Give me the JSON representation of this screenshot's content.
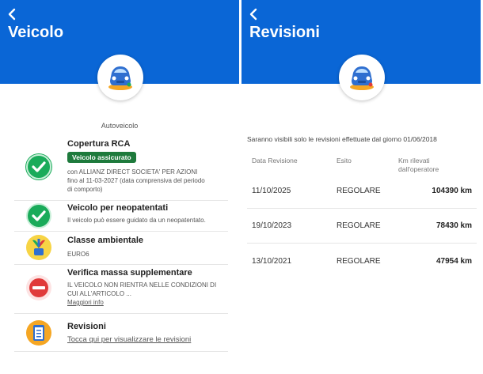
{
  "left": {
    "title": "Veicolo",
    "section_label": "Autoveicolo",
    "rca": {
      "title": "Copertura RCA",
      "badge": "Veicolo assicurato",
      "detail1": "con ALLIANZ DIRECT SOCIETA' PER AZIONI",
      "detail2": "fino al 11-03-2027 (data comprensiva del periodo",
      "detail3": "di comporto)"
    },
    "neopatentati": {
      "title": "Veicolo per neopatentati",
      "detail": "Il veicolo può essere guidato da un neopatentato."
    },
    "classe": {
      "title": "Classe ambientale",
      "detail": "EURO6"
    },
    "massa": {
      "title": "Verifica massa supplementare",
      "detail1": "IL VEICOLO NON RIENTRA NELLE CONDIZIONI DI",
      "detail2": "CUI ALL'ARTICOLO ...",
      "link": "Maggiori info"
    },
    "revisioni": {
      "title": "Revisioni",
      "link": "Tocca qui per visualizzare le revisioni"
    }
  },
  "right": {
    "title": "Revisioni",
    "note": "Saranno visibili solo le revisioni effettuate dal giorno 01/06/2018",
    "columns": {
      "date": "Data Revisione",
      "esito": "Esito",
      "km1": "Km rilevati",
      "km2": "dall'operatore"
    },
    "rows": [
      {
        "date": "11/10/2025",
        "esito": "REGOLARE",
        "km": "104390 km"
      },
      {
        "date": "19/10/2023",
        "esito": "REGOLARE",
        "km": "78430 km"
      },
      {
        "date": "13/10/2021",
        "esito": "REGOLARE",
        "km": "47954 km"
      }
    ]
  },
  "icons": {
    "back": "chevron-left-icon",
    "car": "car-icon",
    "check": "check-icon",
    "eco": "eco-plant-icon",
    "blocked": "no-entry-icon",
    "clipboard": "clipboard-icon"
  },
  "colors": {
    "header": "#0a66d6",
    "check": "#1aab5a",
    "badge": "#1e7a3c",
    "blocked": "#e03a3a",
    "link": "#0a4fc0"
  }
}
